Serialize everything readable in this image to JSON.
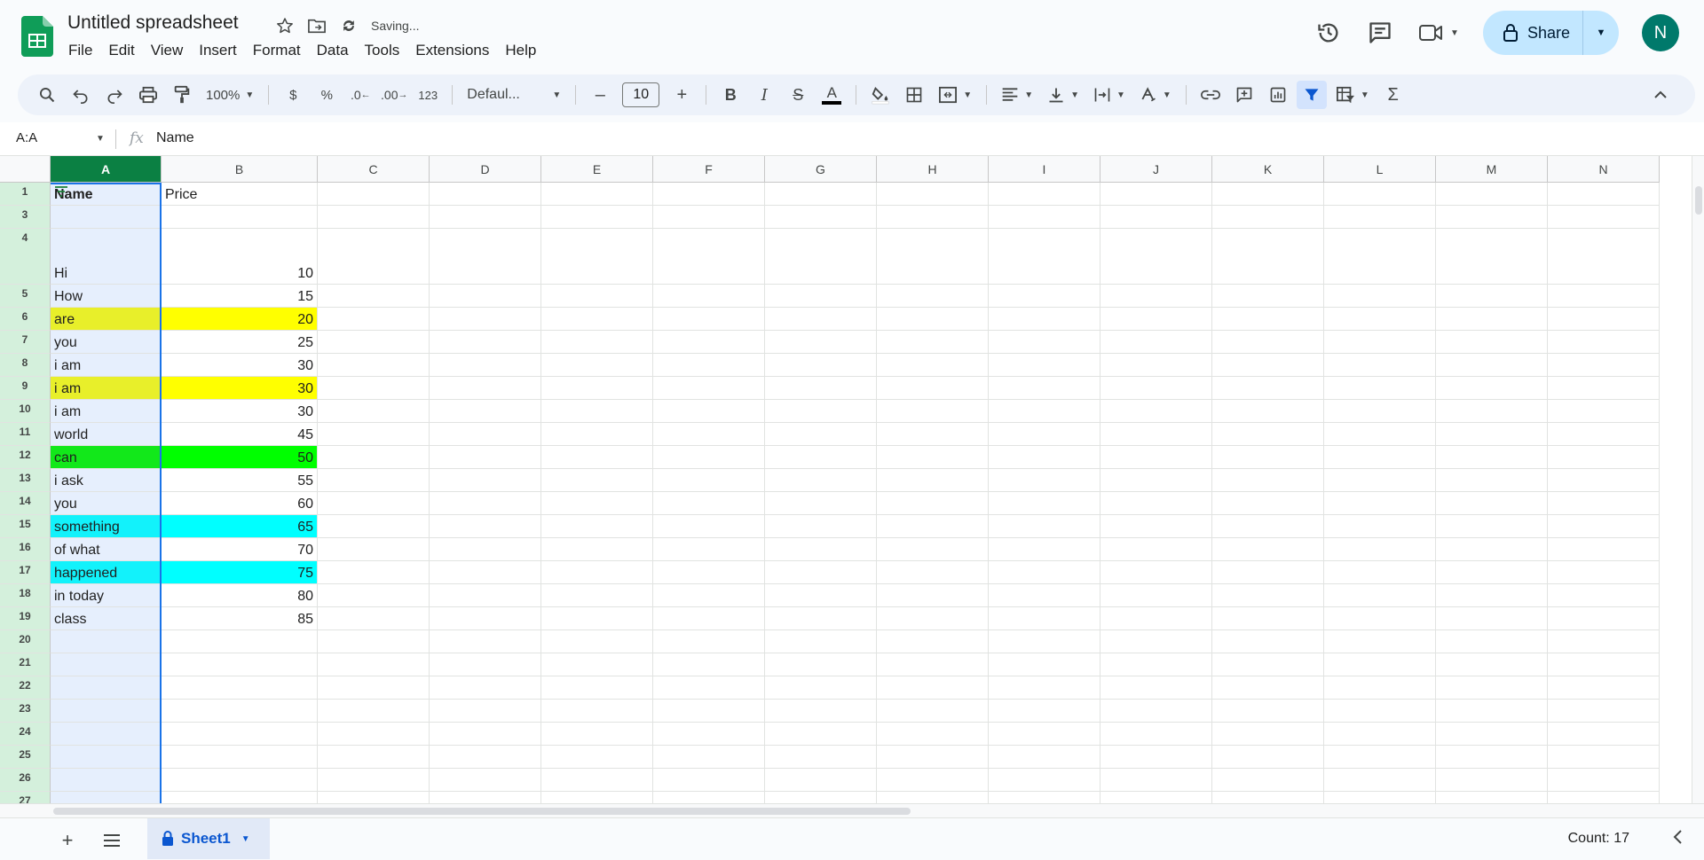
{
  "app": {
    "title": "Untitled spreadsheet",
    "status": "Saving...",
    "accent": "#0b8043",
    "avatar_letter": "N",
    "share_label": "Share"
  },
  "menu": [
    "File",
    "Edit",
    "View",
    "Insert",
    "Format",
    "Data",
    "Tools",
    "Extensions",
    "Help"
  ],
  "toolbar": {
    "zoom": "100%",
    "currency": "$",
    "percent": "%",
    "decrease_decimal": ".0",
    "increase_decimal": ".00",
    "number_format": "123",
    "font": "Defaul...",
    "font_size": "10"
  },
  "formula_bar": {
    "name_box": "A:A",
    "fx": "fx",
    "content": "Name"
  },
  "columns": [
    "A",
    "B",
    "C",
    "D",
    "E",
    "F",
    "G",
    "H",
    "I",
    "J",
    "K",
    "L",
    "M",
    "N"
  ],
  "rows": [
    {
      "num": "1",
      "a": "Name",
      "b": "Price",
      "bg": "",
      "header": true
    },
    {
      "num": "3",
      "a": "",
      "b": "",
      "bg": ""
    },
    {
      "num": "4",
      "a": "Hi",
      "b": "10",
      "bg": ""
    },
    {
      "num": "5",
      "a": "How",
      "b": "15",
      "bg": ""
    },
    {
      "num": "6",
      "a": "are",
      "b": "20",
      "bg": "#ffff00"
    },
    {
      "num": "7",
      "a": "you",
      "b": "25",
      "bg": ""
    },
    {
      "num": "8",
      "a": "i am",
      "b": "30",
      "bg": ""
    },
    {
      "num": "9",
      "a": "i am",
      "b": "30",
      "bg": "#ffff00"
    },
    {
      "num": "10",
      "a": "i am",
      "b": "30",
      "bg": ""
    },
    {
      "num": "11",
      "a": "world",
      "b": "45",
      "bg": ""
    },
    {
      "num": "12",
      "a": "can",
      "b": "50",
      "bg": "#00ff00"
    },
    {
      "num": "13",
      "a": "i ask",
      "b": "55",
      "bg": ""
    },
    {
      "num": "14",
      "a": "you",
      "b": "60",
      "bg": ""
    },
    {
      "num": "15",
      "a": "something",
      "b": "65",
      "bg": "#00ffff"
    },
    {
      "num": "16",
      "a": "of what",
      "b": "70",
      "bg": ""
    },
    {
      "num": "17",
      "a": "happened",
      "b": "75",
      "bg": "#00ffff"
    },
    {
      "num": "18",
      "a": "in today",
      "b": "80",
      "bg": ""
    },
    {
      "num": "19",
      "a": "class",
      "b": "85",
      "bg": ""
    },
    {
      "num": "20",
      "a": "",
      "b": "",
      "bg": ""
    },
    {
      "num": "21",
      "a": "",
      "b": "",
      "bg": ""
    },
    {
      "num": "22",
      "a": "",
      "b": "",
      "bg": ""
    },
    {
      "num": "23",
      "a": "",
      "b": "",
      "bg": ""
    },
    {
      "num": "24",
      "a": "",
      "b": "",
      "bg": ""
    },
    {
      "num": "25",
      "a": "",
      "b": "",
      "bg": ""
    },
    {
      "num": "26",
      "a": "",
      "b": "",
      "bg": ""
    },
    {
      "num": "27",
      "a": "",
      "b": "",
      "bg": ""
    }
  ],
  "sheet": {
    "tab_name": "Sheet1",
    "count": "Count: 17"
  }
}
